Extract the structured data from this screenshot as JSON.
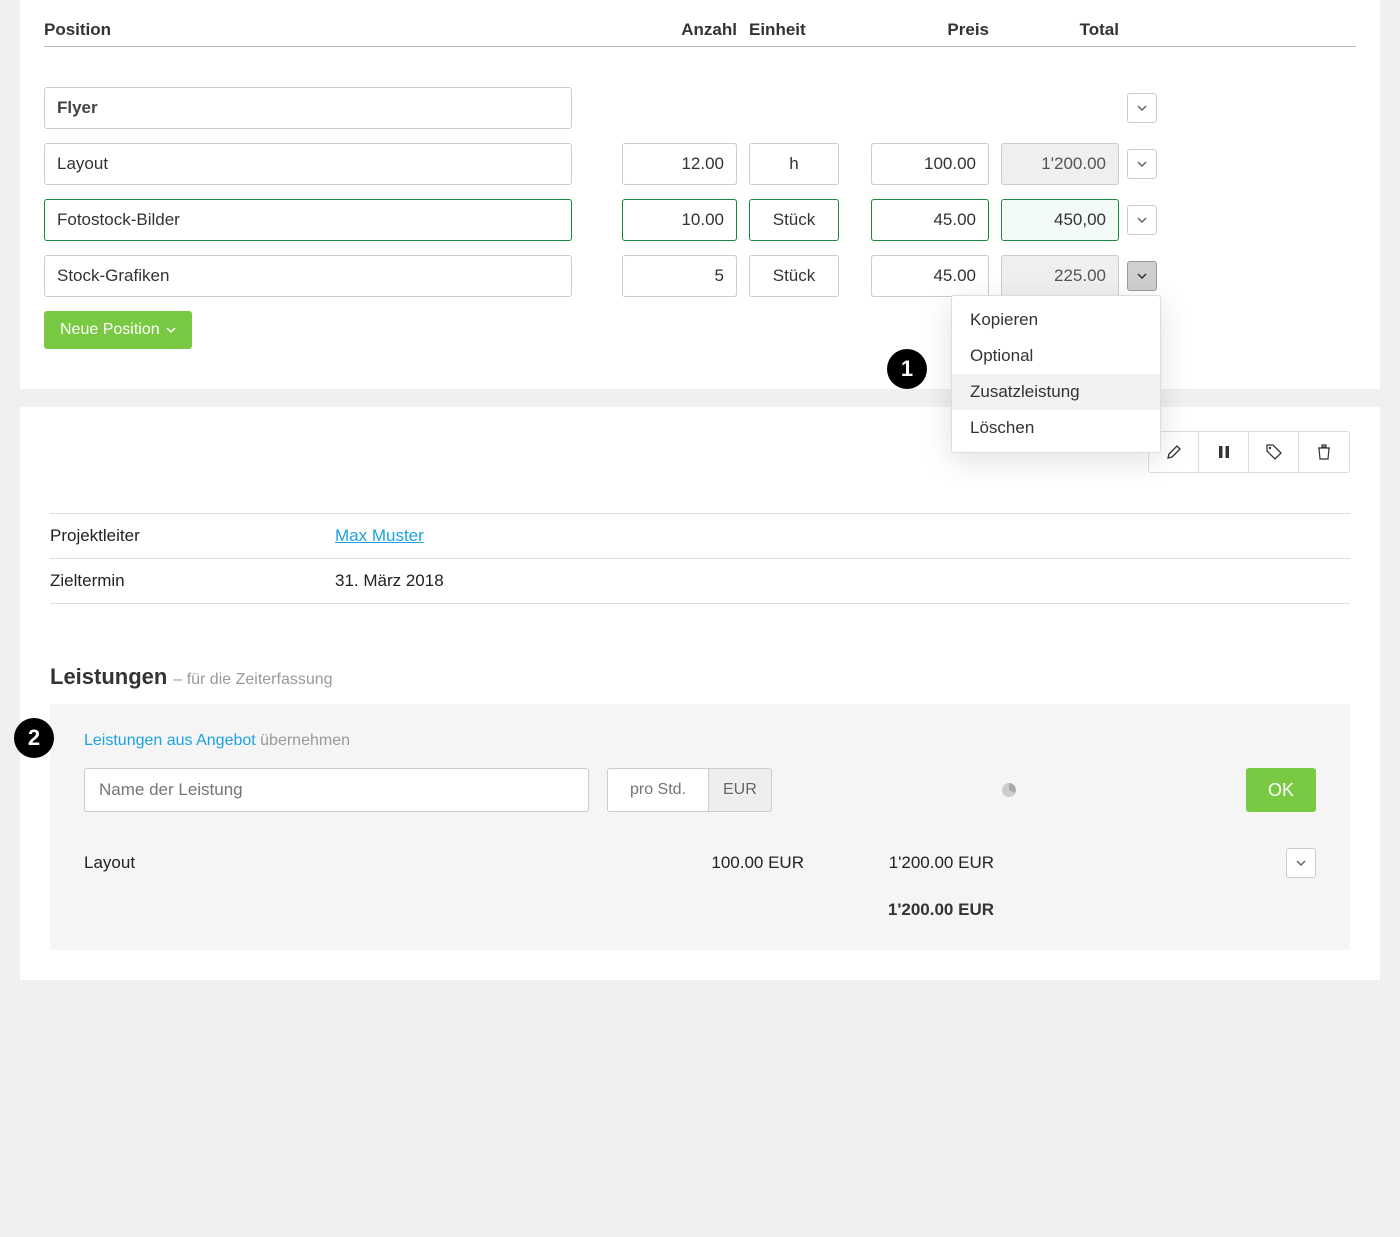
{
  "columns": {
    "position": "Position",
    "anzahl": "Anzahl",
    "einheit": "Einheit",
    "preis": "Preis",
    "total": "Total"
  },
  "lines": {
    "flyer": {
      "name": "Flyer"
    },
    "layout": {
      "name": "Layout",
      "qty": "12.00",
      "unit": "h",
      "price": "100.00",
      "total": "1'200.00"
    },
    "foto": {
      "name": "Fotostock-Bilder",
      "qty": "10.00",
      "unit": "Stück",
      "price": "45.00",
      "total": "450,00"
    },
    "stock": {
      "name": "Stock-Grafiken",
      "qty": "5",
      "unit": "Stück",
      "price": "45.00",
      "total": "225.00"
    }
  },
  "buttons": {
    "new_position": "Neue Position",
    "ok": "OK"
  },
  "row_menu": {
    "copy": "Kopieren",
    "optional": "Optional",
    "zusatz": "Zusatzleistung",
    "delete": "Löschen"
  },
  "project": {
    "leader_label": "Projektleiter",
    "leader_value": "Max Muster",
    "deadline_label": "Zieltermin",
    "deadline_value": "31. März 2018"
  },
  "leistungen": {
    "title": "Leistungen",
    "subtitle": "– für die Zeiterfassung",
    "import_link": "Leistungen aus Angebot",
    "import_suffix": "übernehmen",
    "name_placeholder": "Name der Leistung",
    "rate_placeholder": "pro Std.",
    "currency": "EUR",
    "row": {
      "name": "Layout",
      "rate": "100.00 EUR",
      "total": "1'200.00 EUR"
    },
    "grand_total": "1'200.00 EUR"
  },
  "annotations": {
    "one": "1",
    "two": "2"
  }
}
